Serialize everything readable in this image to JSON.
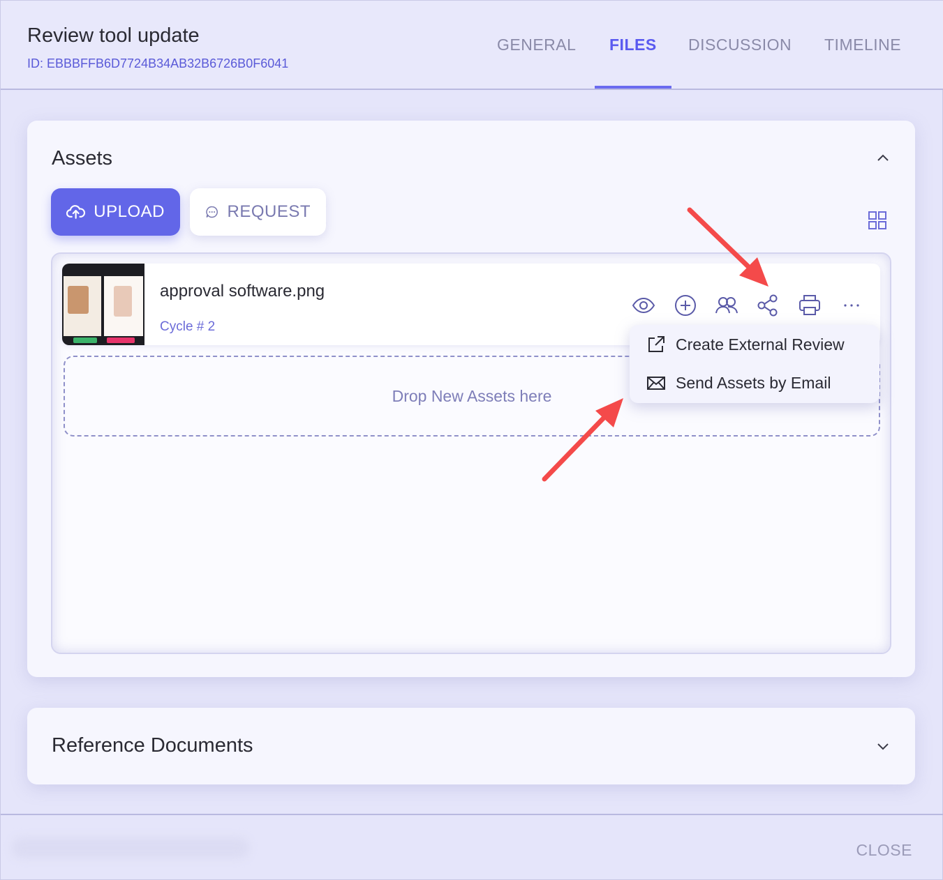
{
  "header": {
    "title": "Review tool update",
    "id_text": "ID: EBBBFFB6D7724B34AB32B6726B0F6041",
    "tabs": [
      {
        "label": "GENERAL",
        "active": false
      },
      {
        "label": "FILES",
        "active": true
      },
      {
        "label": "DISCUSSION",
        "active": false
      },
      {
        "label": "TIMELINE",
        "active": false
      }
    ]
  },
  "assets": {
    "title": "Assets",
    "upload_label": "UPLOAD",
    "request_label": "REQUEST",
    "items": [
      {
        "name": "approval software.png",
        "cycle": "Cycle # 2"
      }
    ],
    "dropzone_text": "Drop New Assets here",
    "share_menu": {
      "items": [
        {
          "label": "Create External Review",
          "icon": "external-link-icon"
        },
        {
          "label": "Send Assets by Email",
          "icon": "envelope-icon"
        }
      ]
    }
  },
  "reference_documents": {
    "title": "Reference Documents"
  },
  "footer": {
    "close_label": "CLOSE"
  },
  "colors": {
    "accent": "#6266e8",
    "annotation_arrow": "#f44a4a"
  }
}
